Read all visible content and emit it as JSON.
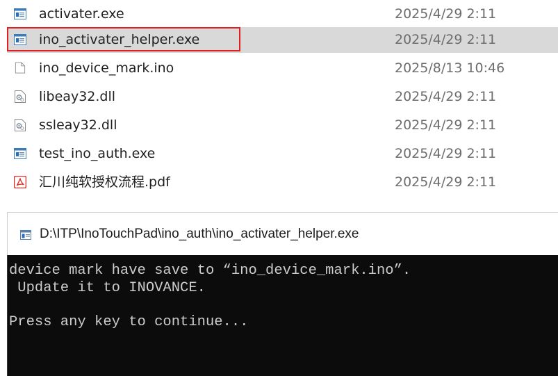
{
  "files": [
    {
      "name": "activater.exe",
      "date": "2025/4/29 2:11",
      "icon": "exe-icon"
    },
    {
      "name": "ino_activater_helper.exe",
      "date": "2025/4/29 2:11",
      "icon": "exe-icon"
    },
    {
      "name": "ino_device_mark.ino",
      "date": "2025/8/13 10:46",
      "icon": "blank-file-icon"
    },
    {
      "name": "libeay32.dll",
      "date": "2025/4/29 2:11",
      "icon": "dll-icon"
    },
    {
      "name": "ssleay32.dll",
      "date": "2025/4/29 2:11",
      "icon": "dll-icon"
    },
    {
      "name": "test_ino_auth.exe",
      "date": "2025/4/29 2:11",
      "icon": "exe-icon"
    },
    {
      "name": "汇川纯软授权流程.pdf",
      "date": "2025/4/29 2:11",
      "icon": "pdf-icon"
    }
  ],
  "console": {
    "title": "D:\\ITP\\InoTouchPad\\ino_auth\\ino_activater_helper.exe",
    "lines": [
      "device mark have save to “ino_device_mark.ino”.",
      " Update it to INOVANCE.",
      "",
      "Press any key to continue..."
    ]
  },
  "colors": {
    "highlight_border": "#e02020",
    "selected_row": "#d9d9d9",
    "console_bg": "#0c0c0c",
    "console_text": "#cccccc",
    "date_text": "#6d6d6d"
  }
}
